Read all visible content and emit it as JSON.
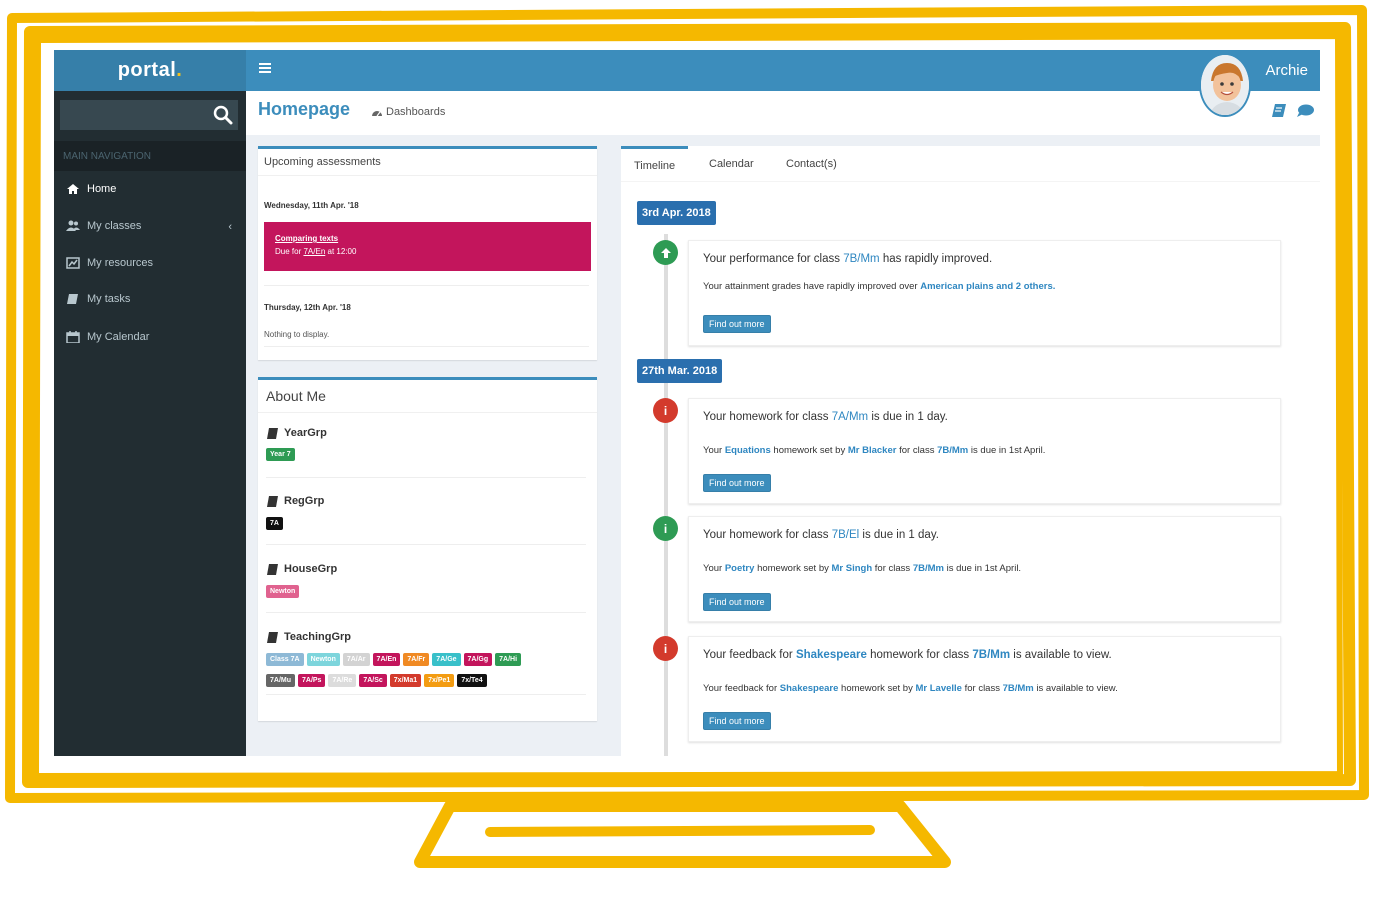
{
  "brand": {
    "name": "portal",
    "dot": "."
  },
  "topbar": {
    "username": "Archie"
  },
  "sidebar": {
    "search_placeholder": "",
    "nav_header": "MAIN NAVIGATION",
    "items": [
      {
        "label": "Home",
        "icon": "home-icon"
      },
      {
        "label": "My classes",
        "icon": "users-icon"
      },
      {
        "label": "My resources",
        "icon": "resources-icon"
      },
      {
        "label": "My tasks",
        "icon": "book-icon"
      },
      {
        "label": "My Calendar",
        "icon": "calendar-icon"
      }
    ]
  },
  "header": {
    "title": "Homepage",
    "crumb": "Dashboards"
  },
  "assessments": {
    "title": "Upcoming assessments",
    "day1": "Wednesday, 11th Apr. '18",
    "card_title": "Comparing texts",
    "card_due_prefix": "Due for",
    "card_class": "7A/En",
    "card_time": "at 12:00",
    "day2": "Thursday, 12th Apr. '18",
    "nothing": "Nothing to display."
  },
  "about": {
    "title": "About Me",
    "yeargrp_label": "YearGrp",
    "yeargrp_tag": "Year 7",
    "reggrp_label": "RegGrp",
    "reggrp_tag": "7A",
    "housegrp_label": "HouseGrp",
    "housegrp_tag": "Newton",
    "teachinggrp_label": "TeachingGrp",
    "teaching_row1": [
      {
        "label": "Class 7A",
        "color": "#8eb9d6"
      },
      {
        "label": "Newton",
        "color": "#7dd5dc"
      },
      {
        "label": "7A/Ar",
        "color": "#d3d3d3"
      },
      {
        "label": "7A/En",
        "color": "#c3155c"
      },
      {
        "label": "7A/Fr",
        "color": "#f08a24"
      },
      {
        "label": "7A/Ge",
        "color": "#39c0c9"
      },
      {
        "label": "7A/Gg",
        "color": "#c3155c"
      },
      {
        "label": "7A/Hi",
        "color": "#2e9b54"
      }
    ],
    "teaching_row2": [
      {
        "label": "7A/Mu",
        "color": "#666666"
      },
      {
        "label": "7A/Ps",
        "color": "#c3155c"
      },
      {
        "label": "7A/Re",
        "color": "#dcdcdc"
      },
      {
        "label": "7A/Sc",
        "color": "#c3155c"
      },
      {
        "label": "7x/Ma1",
        "color": "#d33a2c"
      },
      {
        "label": "7x/Pe1",
        "color": "#f39c12"
      },
      {
        "label": "7x/Te4",
        "color": "#111111"
      }
    ]
  },
  "timeline": {
    "tabs": [
      "Timeline",
      "Calendar",
      "Contact(s)"
    ],
    "date1": "3rd Apr. 2018",
    "date2": "27th Mar. 2018",
    "btn": "Find out more",
    "e1": {
      "h_pre": "Your performance for class",
      "h_class": "7B/Mm",
      "h_post": "has rapidly improved.",
      "b_pre": "Your attainment grades have rapidly improved over",
      "b_hl": "American plains and 2 others."
    },
    "e2": {
      "h_pre": "Your homework for class",
      "h_class": "7A/Mm",
      "h_post": "is due in 1 day.",
      "b1": "Your",
      "b_subj": "Equations",
      "b2": "homework set by",
      "b_teacher": "Mr Blacker",
      "b3": "for class",
      "b_class": "7B/Mm",
      "b4": "is due in 1st April."
    },
    "e3": {
      "h_pre": "Your homework for class",
      "h_class": "7B/El",
      "h_post": "is due in 1 day.",
      "b1": "Your",
      "b_subj": "Poetry",
      "b2": "homework set by",
      "b_teacher": "Mr Singh",
      "b3": "for class",
      "b_class": "7B/Mm",
      "b4": "is due in 1st April."
    },
    "e4": {
      "h_pre": "Your feedback for",
      "h_subj": "Shakespeare",
      "h_mid": "homework for class",
      "h_class": "7B/Mm",
      "h_post": "is available to view.",
      "b1": "Your feedback for",
      "b_subj": "Shakespeare",
      "b2": "homework set by",
      "b_teacher": "Mr Lavelle",
      "b3": "for class",
      "b_class": "7B/Mm",
      "b4": "is available to view."
    }
  },
  "colors": {
    "accent": "#3c8dbc",
    "frame": "#f5b800",
    "sidebar": "#222d32",
    "assessment": "#c3155c"
  }
}
